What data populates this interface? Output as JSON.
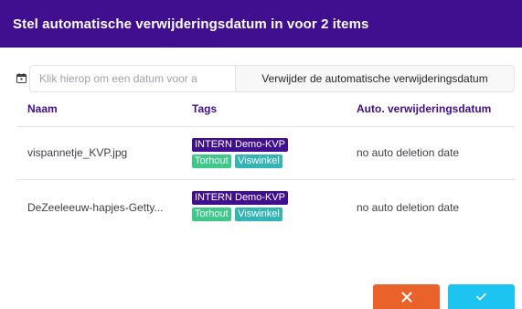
{
  "dialog": {
    "title": "Stel automatische verwijderingsdatum in voor 2 items"
  },
  "date_picker": {
    "icon": "calendar-icon",
    "placeholder": "Klik hierop om een datum voor a"
  },
  "remove_button_label": "Verwijder de automatische verwijderingsdatum",
  "table": {
    "columns": [
      "Naam",
      "Tags",
      "Auto. verwijderingsdatum"
    ],
    "rows": [
      {
        "name": "vispannetje_KVP.jpg",
        "tags": [
          "INTERN Demo-KVP",
          "Torhout",
          "Viswinkel"
        ],
        "date": "no auto deletion date"
      },
      {
        "name": "DeZeeleeuw-hapjes-Getty...",
        "tags": [
          "INTERN Demo-KVP",
          "Torhout",
          "Viswinkel"
        ],
        "date": "no auto deletion date"
      }
    ]
  },
  "actions": {
    "cancel_icon": "close-icon",
    "confirm_icon": "check-icon"
  },
  "colors": {
    "header": "#3f0f8f",
    "accent": "#3f0f8f",
    "tag_intern": "#3f0f8f",
    "tag_torhout": "#3ec98a",
    "tag_viswinkel": "#33b5b5",
    "cancel": "#e8622a",
    "confirm": "#1cc4ef"
  }
}
